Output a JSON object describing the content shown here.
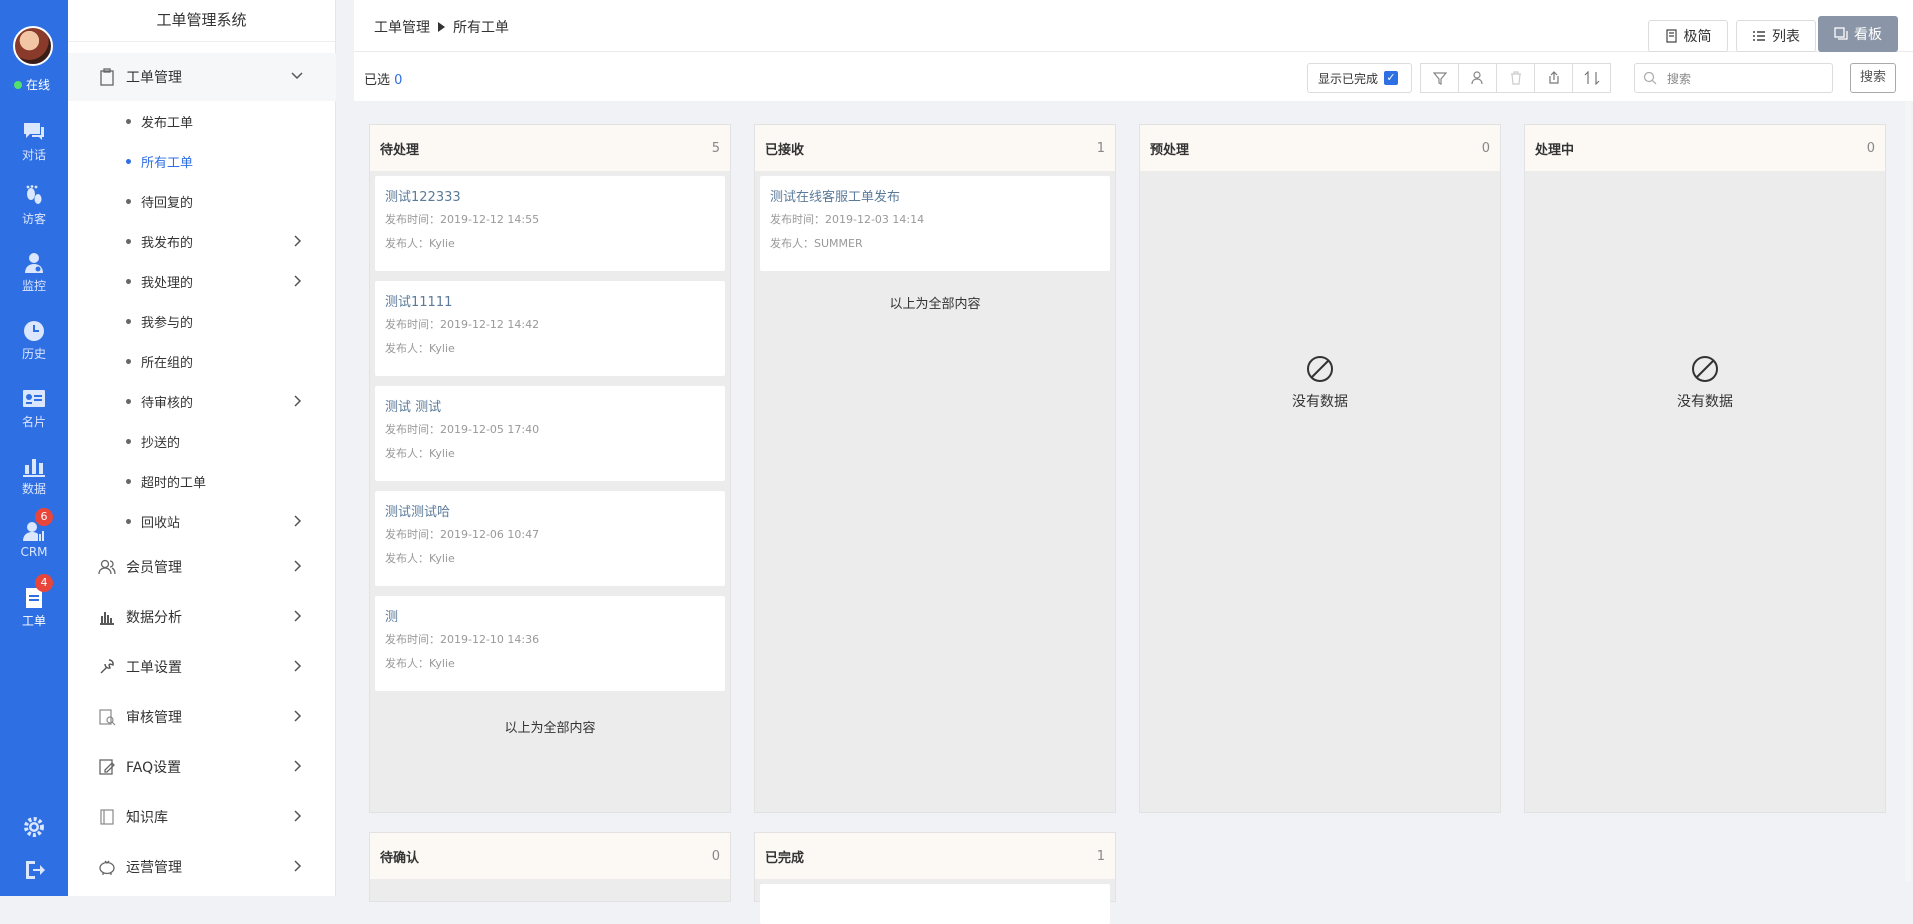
{
  "rail": {
    "status": "在线",
    "items": [
      {
        "label": "对话",
        "icon": "chat-icon"
      },
      {
        "label": "访客",
        "icon": "footprint-icon"
      },
      {
        "label": "监控",
        "icon": "monitor-user-icon"
      },
      {
        "label": "历史",
        "icon": "clock-icon"
      },
      {
        "label": "名片",
        "icon": "card-icon"
      },
      {
        "label": "数据",
        "icon": "bar-chart-icon"
      },
      {
        "label": "CRM",
        "icon": "crm-icon",
        "badge": "6"
      },
      {
        "label": "工单",
        "icon": "ticket-icon",
        "badge": "4"
      }
    ]
  },
  "menu": {
    "title": "工单管理系统",
    "groups": {
      "ticket": "工单管理",
      "member": "会员管理",
      "analysis": "数据分析",
      "settings": "工单设置",
      "review": "审核管理",
      "faq": "FAQ设置",
      "kb": "知识库",
      "ops": "运营管理"
    },
    "subs": [
      "发布工单",
      "所有工单",
      "待回复的",
      "我发布的",
      "我处理的",
      "我参与的",
      "所在组的",
      "待审核的",
      "抄送的",
      "超时的工单",
      "回收站"
    ]
  },
  "breadcrumb": {
    "root": "工单管理",
    "current": "所有工单"
  },
  "views": {
    "simple": "极简",
    "list": "列表",
    "board": "看板"
  },
  "toolbar": {
    "selected_label": "已选",
    "selected_count": "0",
    "show_done": "显示已完成",
    "search_placeholder": "搜索",
    "search_button": "搜索"
  },
  "columns": [
    {
      "title": "待处理",
      "count": "5"
    },
    {
      "title": "已接收",
      "count": "1"
    },
    {
      "title": "预处理",
      "count": "0"
    },
    {
      "title": "处理中",
      "count": "0"
    },
    {
      "title": "待确认",
      "count": "0"
    },
    {
      "title": "已完成",
      "count": "1"
    }
  ],
  "cards_pending": [
    {
      "title": "测试122333",
      "time": "发布时间：2019-12-12 14:55",
      "author": "发布人：Kylie"
    },
    {
      "title": "测试11111",
      "time": "发布时间：2019-12-12 14:42",
      "author": "发布人：Kylie"
    },
    {
      "title": "测试 测试",
      "time": "发布时间：2019-12-05 17:40",
      "author": "发布人：Kylie"
    },
    {
      "title": "测试测试哈",
      "time": "发布时间：2019-12-06 10:47",
      "author": "发布人：Kylie"
    },
    {
      "title": "测",
      "time": "发布时间：2019-12-10 14:36",
      "author": "发布人：Kylie"
    }
  ],
  "cards_received": [
    {
      "title": "测试在线客服工单发布",
      "time": "发布时间：2019-12-03 14:14",
      "author": "发布人：SUMMER"
    }
  ],
  "end_text": "以上为全部内容",
  "empty_text": "没有数据"
}
